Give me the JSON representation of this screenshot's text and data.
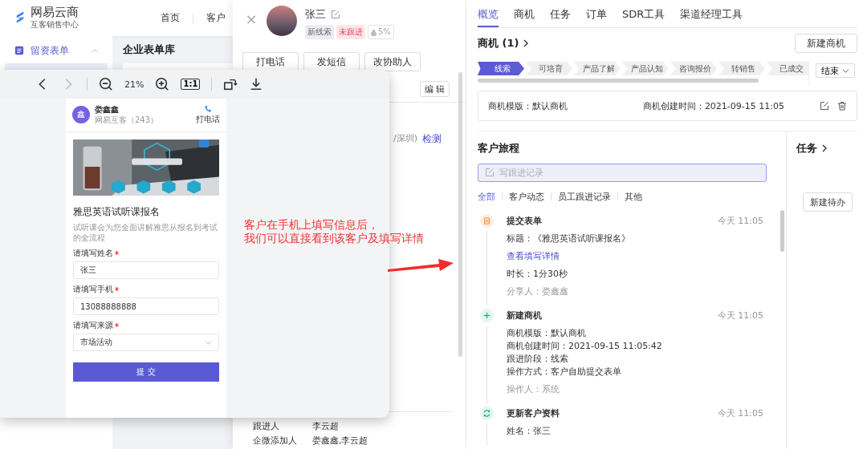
{
  "app": {
    "logo": {
      "name": "网易云商",
      "subtitle": "互客销售中心"
    },
    "nav": [
      {
        "label": "首页"
      },
      {
        "label": "客户"
      }
    ],
    "sidebar": {
      "items": [
        {
          "label": "留资表单",
          "expanded": true
        }
      ]
    },
    "content_title": "企业表单库"
  },
  "drawer": {
    "close": "×",
    "customer": {
      "name": "张三",
      "tags": [
        {
          "label": "新线索",
          "kind": "neutral"
        },
        {
          "label": "未跟进",
          "kind": "warning"
        },
        {
          "label": "5%",
          "kind": "score"
        }
      ]
    },
    "actions": [
      "打电话",
      "发短信",
      "改协助人"
    ],
    "edit_button": "编 辑",
    "location_fragment": "/深圳)",
    "detect_link": "检测",
    "fields": [
      {
        "label": "跟进人",
        "value": "李云超"
      },
      {
        "label": "企微添加人",
        "value": "娄鑫鑫,李云超"
      }
    ]
  },
  "detail": {
    "tabs": [
      {
        "label": "概览",
        "selected": true
      },
      {
        "label": "商机",
        "selected": false
      },
      {
        "label": "任务",
        "selected": false
      },
      {
        "label": "订单",
        "selected": false
      },
      {
        "label": "SDR工具",
        "selected": false
      },
      {
        "label": "渠道经理工具",
        "selected": false
      }
    ],
    "opportunities": {
      "title": "商机 (1)",
      "new_button": "新建商机",
      "stages": [
        {
          "label": "线索",
          "selected": true
        },
        {
          "label": "可培育",
          "selected": false
        },
        {
          "label": "产品了解",
          "selected": false
        },
        {
          "label": "产品认知",
          "selected": false
        },
        {
          "label": "咨询报价",
          "selected": false
        },
        {
          "label": "转销售",
          "selected": false
        },
        {
          "label": "已成交",
          "selected": false
        }
      ],
      "end_select": "结束",
      "card": {
        "template": "商机模版：默认商机",
        "created": "商机创建时间：2021-09-15 11:05"
      }
    },
    "journey": {
      "title": "客户旅程",
      "placeholder": "写跟进记录",
      "filters": [
        {
          "label": "全部",
          "selected": true
        },
        {
          "label": "客户动态",
          "selected": false
        },
        {
          "label": "员工跟进记录",
          "selected": false
        },
        {
          "label": "其他",
          "selected": false
        }
      ],
      "events": [
        {
          "kind": "form",
          "title": "提交表单",
          "time": "今天 11:05",
          "lines": [
            "标题：《雅思英语试听课报名》"
          ],
          "link": "查看填写详情",
          "extra": [
            "时长：1分30秒"
          ],
          "meta": "分享人：娄鑫鑫"
        },
        {
          "kind": "create",
          "title": "新建商机",
          "time": "今天 11:05",
          "lines": [
            "商机模版：默认商机",
            "商机创建时间：2021-09-15 11:05:42",
            "跟进阶段：线索",
            "操作方式：客户自助提交表单"
          ],
          "meta": "操作人：系统"
        },
        {
          "kind": "update",
          "title": "更新客户资料",
          "time": "今天 11:05",
          "lines": [
            "姓名：张三"
          ]
        }
      ]
    },
    "tasks": {
      "title": "任务",
      "new_button": "新建待办"
    }
  },
  "viewer": {
    "toolbar": [
      {
        "kind": "prev",
        "disabled": false
      },
      {
        "kind": "next",
        "disabled": true
      },
      {
        "kind": "zoom_out",
        "disabled": false
      },
      {
        "kind": "zoom_level",
        "label": "21%",
        "disabled": false
      },
      {
        "kind": "zoom_in",
        "disabled": false
      },
      {
        "kind": "actual_size",
        "label": "1:1",
        "disabled": false
      },
      {
        "kind": "rotate",
        "disabled": false
      },
      {
        "kind": "download",
        "disabled": false
      }
    ],
    "form": {
      "sharer": {
        "avatar": "鑫",
        "name": "娄鑫鑫",
        "org": "网易互客（243）",
        "call": "打电话"
      },
      "title": "雅思英语试听课报名",
      "description": "试听课会为您全面讲解雅思从报名到考试的全流程",
      "fields": [
        {
          "kind": "text",
          "label": "请填写姓名",
          "required": true,
          "value": "张三"
        },
        {
          "kind": "text",
          "label": "请填写手机",
          "required": true,
          "value": "13088888888"
        },
        {
          "kind": "select",
          "label": "请填写来源",
          "required": true,
          "value": "市场活动"
        }
      ],
      "submit": "提 交"
    }
  },
  "annotation": {
    "lines": [
      "客户在手机上填写信息后，",
      "我们可以直接看到该客户及填写详情"
    ]
  }
}
